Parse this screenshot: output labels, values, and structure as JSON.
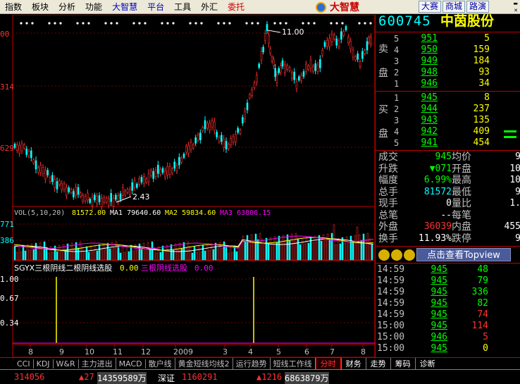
{
  "menu": [
    "指数",
    "板块",
    "分析",
    "功能",
    "大智慧",
    "平台",
    "工具",
    "外汇",
    "委托"
  ],
  "logo_text": "大智慧",
  "top_buttons": [
    "大赛",
    "商城",
    "路演"
  ],
  "stock": {
    "code": "600745",
    "name": "中茵股份"
  },
  "chart": {
    "price_axis_labels": [
      "00",
      "314",
      "629"
    ],
    "high_label": "11.00",
    "low_label": "2.43",
    "vol_axis_labels": [
      "771",
      "386"
    ],
    "indicator_axis_labels": [
      "1.00",
      "0.67",
      "0.34"
    ],
    "x_labels": [
      "8",
      "9",
      "10",
      "11",
      "12",
      "2009",
      "3",
      "4",
      "5",
      "6",
      "7",
      "8"
    ],
    "vol_header": {
      "title": "VOL(5,10,20)",
      "vol": "81572.00",
      "ma1": "MA1 79640.60",
      "ma2": "MA2 59834.60",
      "ma3": "MA3 63806.15"
    },
    "ind_header": {
      "title": "SGYX三根阴线二根阴线选股",
      "v1": "0.00",
      "t2": "三根阴线选股",
      "v2": "0.00"
    },
    "ind_spikes": [
      31,
      171
    ]
  },
  "orderbook": {
    "sell_label": [
      "卖",
      "盘"
    ],
    "buy_label": [
      "买",
      "盘"
    ],
    "sell": [
      {
        "idx": "5",
        "price": "951",
        "vol": "5"
      },
      {
        "idx": "4",
        "price": "950",
        "vol": "159"
      },
      {
        "idx": "3",
        "price": "949",
        "vol": "184"
      },
      {
        "idx": "2",
        "price": "948",
        "vol": "93"
      },
      {
        "idx": "1",
        "price": "946",
        "vol": "34"
      }
    ],
    "buy": [
      {
        "idx": "1",
        "price": "945",
        "vol": "8"
      },
      {
        "idx": "2",
        "price": "944",
        "vol": "237"
      },
      {
        "idx": "3",
        "price": "943",
        "vol": "135"
      },
      {
        "idx": "4",
        "price": "942",
        "vol": "409"
      },
      {
        "idx": "5",
        "price": "941",
        "vol": "454"
      }
    ]
  },
  "stats": [
    {
      "l": "成交",
      "v": "945",
      "l2": "均价",
      "v2": "9"
    },
    {
      "l": "升跌",
      "v": "▼071",
      "l2": "开盘",
      "v2": "10"
    },
    {
      "l": "幅度",
      "v": "6.99%",
      "l2": "最高",
      "v2": "10"
    },
    {
      "l": "总手",
      "v": "81572",
      "l2": "最低",
      "v2": "9"
    },
    {
      "l": "现手",
      "v": "0",
      "l2": "量比",
      "v2": "1."
    },
    {
      "l": "总笔",
      "v": "--",
      "l2": "每笔",
      "v2": ""
    },
    {
      "l": "外盘",
      "v": "36039",
      "l2": "内盘",
      "v2": "455"
    },
    {
      "l": "换手",
      "v": "11.93%",
      "l2": "跌停",
      "v2": "9"
    }
  ],
  "topview_button": "点击查看Topview",
  "ticks": [
    {
      "t": "14:59",
      "p": "945",
      "v": "48",
      "c": "#00ff00"
    },
    {
      "t": "14:59",
      "p": "945",
      "v": "79",
      "c": "#00ff00"
    },
    {
      "t": "14:59",
      "p": "945",
      "v": "336",
      "c": "#00ff00"
    },
    {
      "t": "14:59",
      "p": "945",
      "v": "82",
      "c": "#00ff00"
    },
    {
      "t": "14:59",
      "p": "945",
      "v": "74",
      "c": "#ff3030"
    },
    {
      "t": "15:00",
      "p": "945",
      "v": "114",
      "c": "#ff3030"
    },
    {
      "t": "15:00",
      "p": "946",
      "v": "5",
      "c": "#ff3030"
    },
    {
      "t": "15:00",
      "p": "945",
      "v": "0",
      "c": "#ffff00"
    }
  ],
  "tabs": [
    "CCI",
    "KDJ",
    "W&R",
    "主力进出",
    "MACD",
    "散户线",
    "黄金短线均线2",
    "运行趋势",
    "短线工作线"
  ],
  "right_tabs": [
    "分时",
    "财务",
    "走势",
    "筹码",
    "诊断"
  ],
  "status": {
    "a": "314056",
    "b": "▲27",
    "c": "14359589万",
    "d": "深证",
    "e": "1160291",
    "f": "▲1216",
    "g": "6863879万"
  },
  "colors": {
    "up": "#ff3030",
    "down": "#00ffff",
    "yellow": "#ffff00",
    "green": "#00ff00",
    "ma2": "#ff00ff",
    "divider": "#c00000"
  }
}
